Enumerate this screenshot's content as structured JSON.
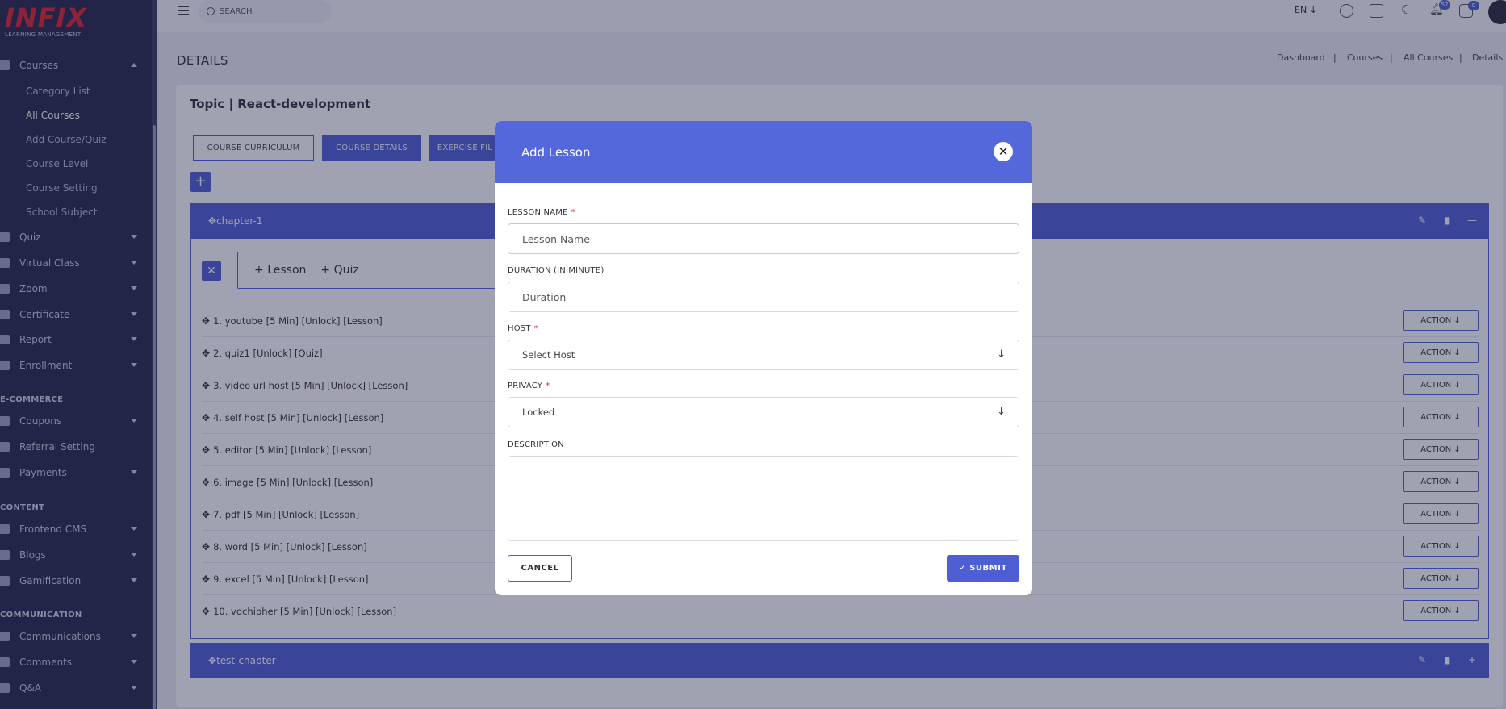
{
  "sidebar": {
    "logo": "INFIX",
    "logo_sub": "LEARNING MANAGEMENT",
    "courses": "Courses",
    "sub": [
      "Category List",
      "All Courses",
      "Add Course/Quiz",
      "Course Level",
      "Course Setting",
      "School Subject"
    ],
    "items1": [
      "Quiz",
      "Virtual Class",
      "Zoom",
      "Certificate",
      "Report",
      "Enrollment"
    ],
    "section_ecommerce": "E-COMMERCE",
    "items2": [
      "Coupons",
      "Referral Setting",
      "Payments"
    ],
    "section_content": "CONTENT",
    "items3": [
      "Frontend CMS",
      "Blogs",
      "Gamification"
    ],
    "section_communication": "COMMUNICATION",
    "items4": [
      "Communications",
      "Comments",
      "Q&A"
    ]
  },
  "topbar": {
    "search_label": "SEARCH",
    "lang": "EN ↓",
    "notif_count": "57",
    "msg_count": "0"
  },
  "page": {
    "title": "DETAILS",
    "breadcrumb": [
      "Dashboard",
      "Courses",
      "All Courses",
      "Details"
    ],
    "breadcrumb_sep": "|",
    "topic": "Topic | React-development",
    "tabs": [
      "COURSE CURRICULUM",
      "COURSE DETAILS",
      "EXERCISE FIL"
    ],
    "plus": "+",
    "chapter1": "chapter-1",
    "chapter2": "test-chapter",
    "add_lesson": "Lesson",
    "add_quiz": "Quiz",
    "action_label": "ACTION",
    "lessons": [
      "1. youtube [5 Min] [Unlock] [Lesson]",
      "2. quiz1 [Unlock] [Quiz]",
      "3. video url host [5 Min] [Unlock] [Lesson]",
      "4. self host [5 Min] [Unlock] [Lesson]",
      "5. editor [5 Min] [Unlock] [Lesson]",
      "6. image [5 Min] [Unlock] [Lesson]",
      "7. pdf [5 Min] [Unlock] [Lesson]",
      "8. word [5 Min] [Unlock] [Lesson]",
      "9. excel [5 Min] [Unlock] [Lesson]",
      "10. vdchipher [5 Min] [Unlock] [Lesson]"
    ]
  },
  "modal": {
    "title": "Add Lesson",
    "lesson_name_label": "LESSON NAME",
    "lesson_name_placeholder": "Lesson Name",
    "duration_label": "DURATION (IN MINUTE)",
    "duration_placeholder": "Duration",
    "host_label": "HOST",
    "host_value": "Select Host",
    "privacy_label": "PRIVACY",
    "privacy_value": "Locked",
    "description_label": "DESCRIPTION",
    "required_mark": "*",
    "cancel": "CANCEL",
    "submit": "SUBMIT"
  },
  "colors": {
    "accent": "#4e5fd6",
    "sidebar_bg": "#26294a",
    "logo": "#e0242f"
  }
}
